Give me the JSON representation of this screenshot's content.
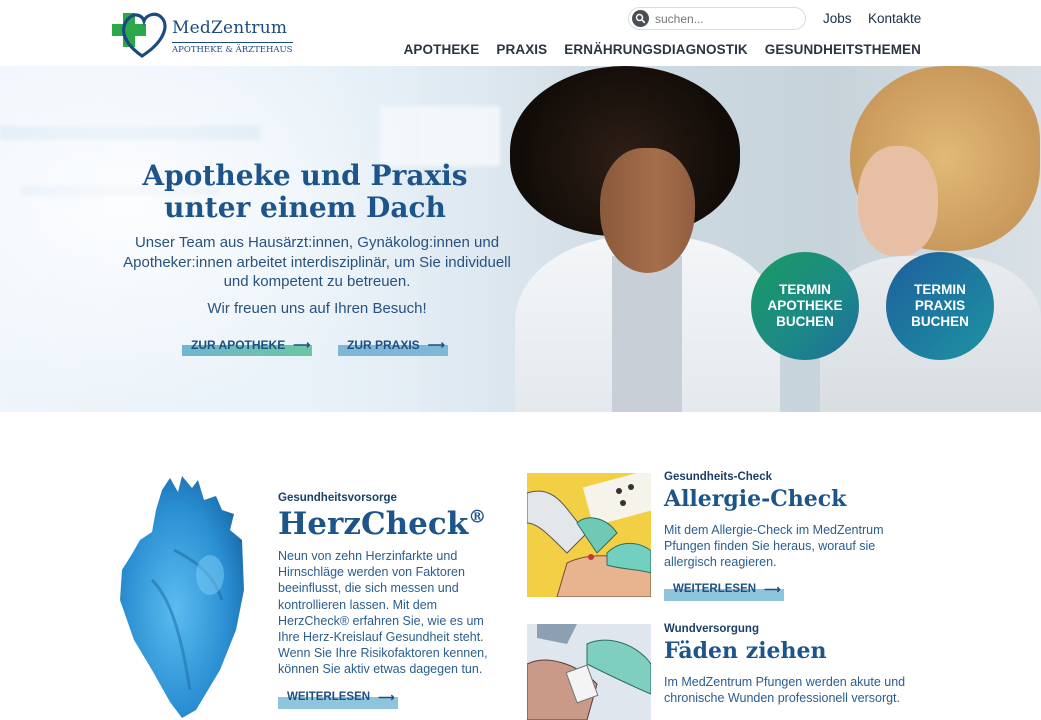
{
  "header": {
    "logo_title": "MedZentrum",
    "logo_subtitle": "APOTHEKE & ÄRZTEHAUS",
    "search_placeholder": "suchen...",
    "top_links": [
      "Jobs",
      "Kontakte"
    ],
    "nav": [
      "APOTHEKE",
      "PRAXIS",
      "ERNÄHRUNGSDIAGNOSTIK",
      "GESUNDHEITSTHEMEN"
    ]
  },
  "hero": {
    "title_line1": "Apotheke und Praxis",
    "title_line2": "unter einem Dach",
    "text": "Unser Team aus Hausärzt:innen, Gynäkolog:innen und Apotheker:innen arbeitet interdisziplinär, um Sie individuell und kompetent zu betreuen.",
    "greeting": "Wir freuen uns auf Ihren Besuch!",
    "btn_apotheke": "ZUR APOTHEKE",
    "btn_praxis": "ZUR PRAXIS",
    "circle_apotheke": [
      "TERMIN",
      "APOTHEKE",
      "BUCHEN"
    ],
    "circle_praxis": [
      "TERMIN",
      "PRAXIS",
      "BUCHEN"
    ]
  },
  "colors": {
    "brand_blue": "#1d548a",
    "brand_green": "#2aa84a",
    "teal": "#1f8f98",
    "button_bar": "#8ec4dc"
  },
  "cards": {
    "herz": {
      "kicker": "Gesundheitsvorsorge",
      "title": "HerzCheck",
      "title_sup": "®",
      "text": "Neun von zehn Herzinfarkte und Hirnschläge werden von Faktoren beeinflusst, die sich messen und kontrollieren lassen. Mit dem HerzCheck® erfahren Sie, wie es um Ihre Herz-Kreislauf Gesundheit steht. Wenn Sie Ihre Risikofaktoren kennen, können Sie aktiv etwas dagegen tun.",
      "more": "WEITERLESEN"
    },
    "allergie": {
      "kicker": "Gesundheits-Check",
      "title": "Allergie-Check",
      "text": "Mit dem Allergie-Check im MedZentrum Pfungen finden Sie heraus, worauf sie allergisch reagieren.",
      "more": "WEITERLESEN"
    },
    "wund": {
      "kicker": "Wundversorgung",
      "title": "Fäden ziehen",
      "text": "Im MedZentrum Pfungen werden akute und chronische Wunden professionell versorgt."
    }
  }
}
